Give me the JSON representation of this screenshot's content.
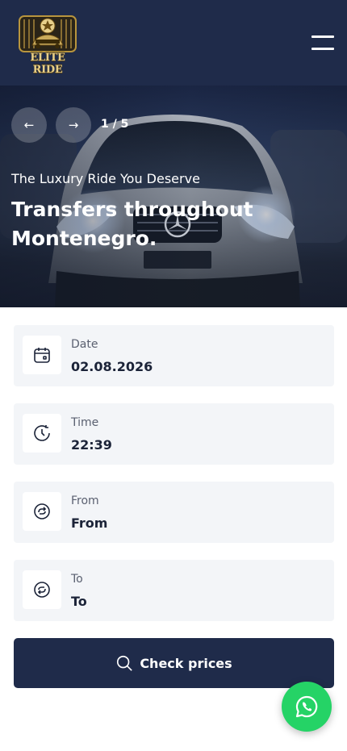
{
  "header": {
    "logo_text": "ELITE RIDE",
    "menu_icon": "hamburger-menu-icon"
  },
  "hero": {
    "prev_icon": "arrow-left-icon",
    "next_icon": "arrow-right-icon",
    "prev_glyph": "←",
    "next_glyph": "→",
    "counter": "1 / 5",
    "eyebrow": "The Luxury Ride You Deserve",
    "title": "Transfers throughout Montenegro."
  },
  "form": {
    "date": {
      "label": "Date",
      "value": "02.08.2026",
      "icon": "calendar-icon"
    },
    "time": {
      "label": "Time",
      "value": "22:39",
      "icon": "clock-icon"
    },
    "from": {
      "label": "From",
      "value": "From",
      "icon": "pickup-location-icon"
    },
    "to": {
      "label": "To",
      "value": "To",
      "icon": "dropoff-location-icon"
    }
  },
  "actions": {
    "check_prices": "Check prices",
    "search_icon": "search-icon"
  },
  "floating": {
    "whatsapp_icon": "whatsapp-icon"
  },
  "colors": {
    "navy": "#1f2b4a",
    "field_bg": "#f3f5f8",
    "whatsapp_green": "#25d366",
    "logo_gold": "#e7cf8a"
  }
}
